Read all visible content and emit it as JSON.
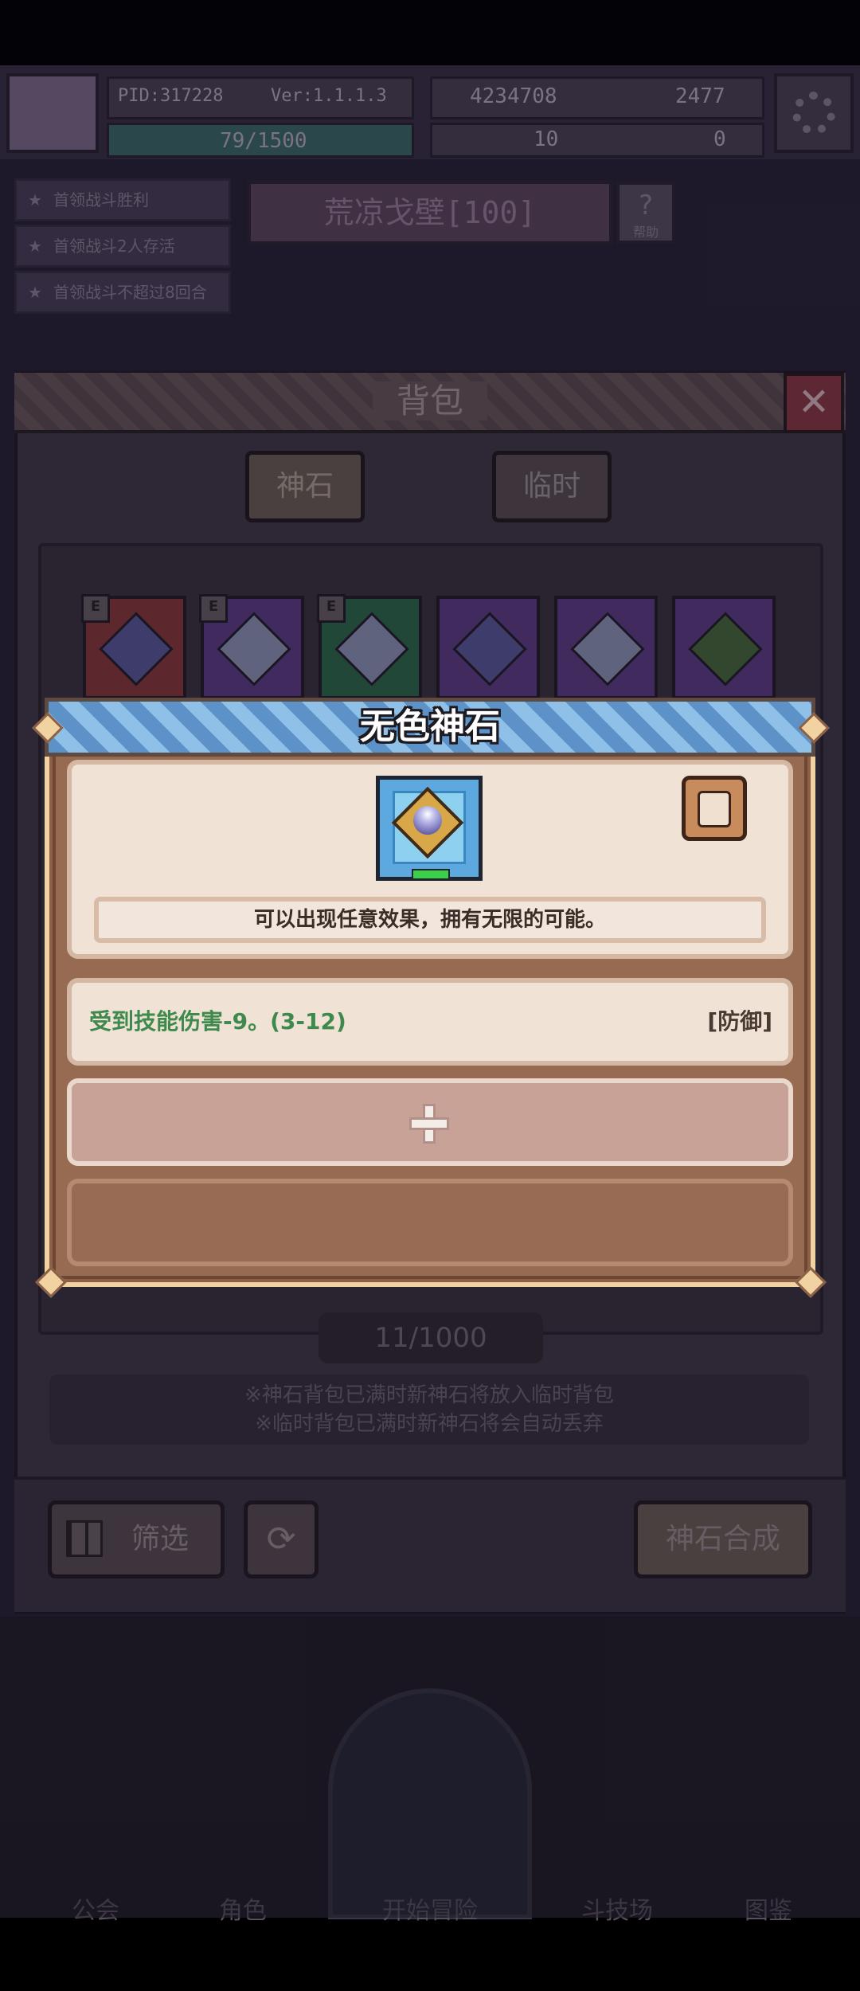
{
  "topbar": {
    "pid": "PID:317228",
    "version": "Ver:1.1.1.3",
    "gold": "4234708",
    "gems": "2477",
    "energy": "79/1500",
    "clovers": "10",
    "tickets": "0"
  },
  "quests": [
    "首领战斗胜利",
    "首领战斗2人存活",
    "首领战斗不超过8回合"
  ],
  "stage": {
    "name": "荒凉戈壁[100]",
    "help_label": "帮助"
  },
  "backpack": {
    "title": "背包",
    "close": "✕",
    "tabs": [
      "神石",
      "临时"
    ],
    "equipped_mark": "E",
    "counter": "11/1000",
    "notes": [
      "※神石背包已满时新神石将放入临时背包",
      "※临时背包已满时新神石将会自动丢弃"
    ],
    "filter_label": "筛选",
    "synth_label": "神石合成",
    "slot_colors": [
      "#8a3a3e",
      "#5e3e88",
      "#2f6a4e",
      "#5e3e88",
      "#5e3e88",
      "#5e3e88"
    ]
  },
  "nav": [
    "公会",
    "角色",
    "开始冒险",
    "斗技场",
    "图鉴"
  ],
  "modal": {
    "title": "无色神石",
    "description": "可以出现任意效果，拥有无限的可能。",
    "attribute": "受到技能伤害-9。(3-12)",
    "attribute_tag": "[防御]",
    "header_color": "#72a8d8",
    "attribute_color": "#3e8a4e"
  }
}
